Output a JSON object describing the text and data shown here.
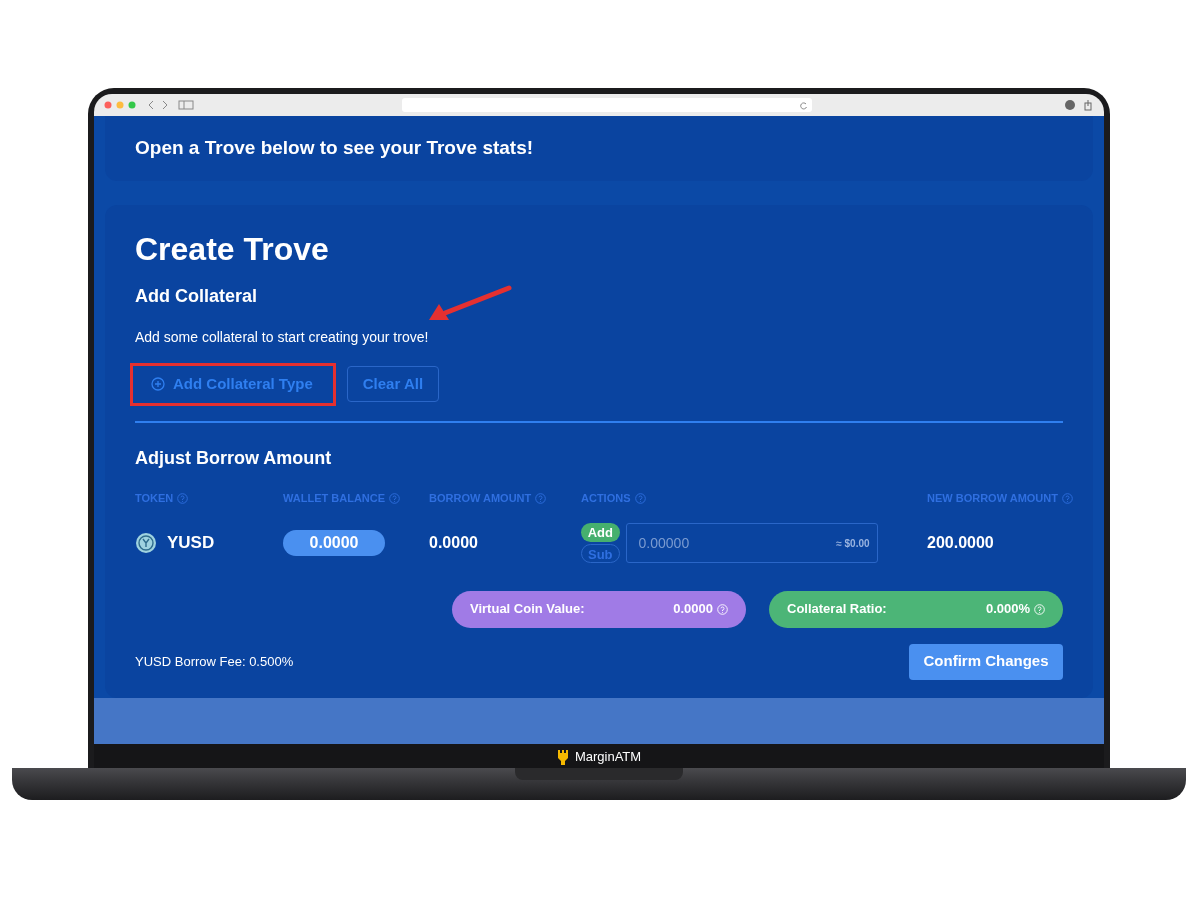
{
  "trove_notice": "Open a Trove below to see your Trove stats!",
  "create_trove": {
    "title": "Create Trove",
    "collateral": {
      "heading": "Add Collateral",
      "message": "Add some collateral to start creating your trove!",
      "buttons": [
        {
          "label": "Add Collateral Type",
          "kind": "add"
        },
        {
          "label": "Clear All",
          "kind": "clear"
        }
      ]
    },
    "borrow": {
      "heading": "Adjust Borrow Amount",
      "columns": [
        "TOKEN",
        "WALLET BALANCE",
        "BORROW AMOUNT",
        "ACTIONS",
        "NEW BORROW AMOUNT"
      ],
      "row": {
        "token": "YUSD",
        "wallet_balance": "0.0000",
        "borrow_amount": "0.0000",
        "actions": [
          {
            "label": "Add",
            "selected": true
          },
          {
            "label": "Sub",
            "selected": false
          }
        ],
        "amount_field": {
          "placeholder": "0.00000",
          "usd": "≈ $0.00"
        },
        "new_borrow_amount": "200.0000"
      }
    },
    "stats": [
      {
        "label": "Virtual Coin Value:",
        "value": "0.0000",
        "color": "#a07be6"
      },
      {
        "label": "Collateral Ratio:",
        "value": "0.000%",
        "color": "#4cb577"
      }
    ],
    "fee": "YUSD Borrow Fee: 0.500%",
    "confirm": "Confirm Changes"
  },
  "device_label": "MarginATM"
}
